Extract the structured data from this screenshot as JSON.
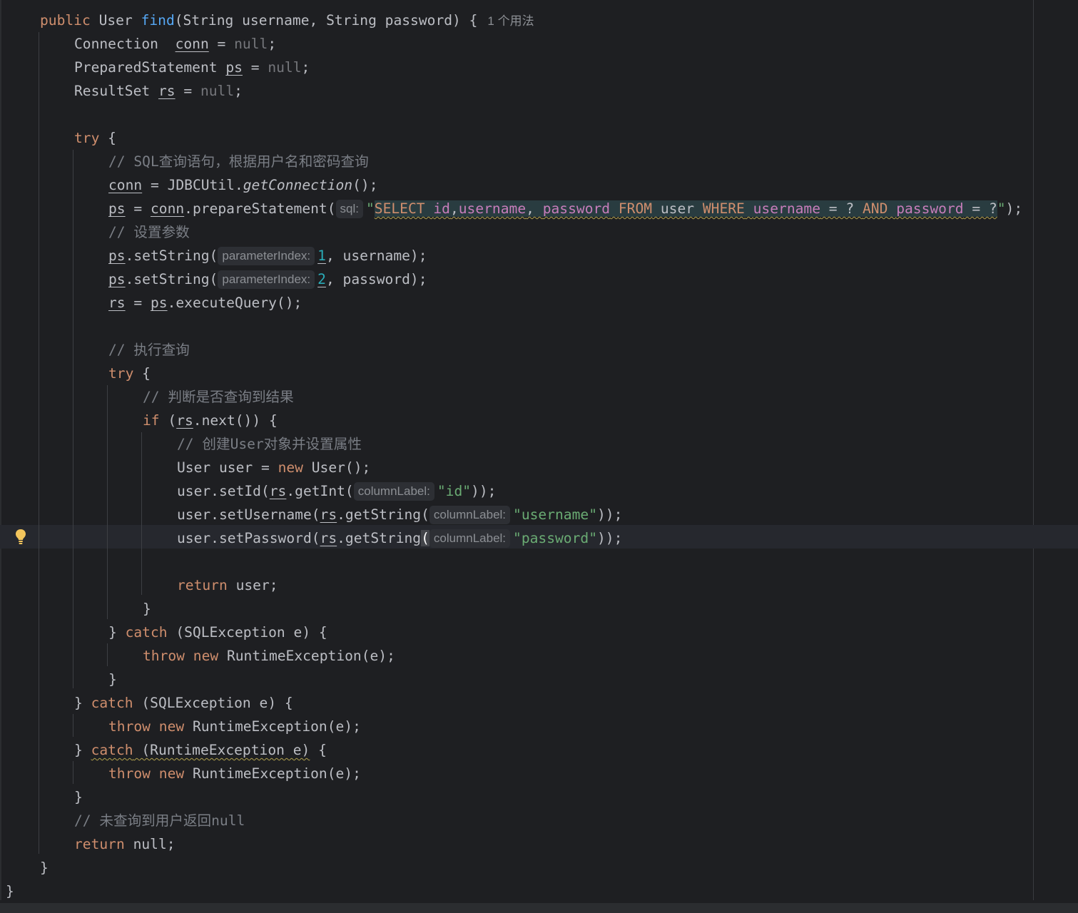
{
  "code": {
    "l1": {
      "kw": "public",
      "type": "User",
      "fn": "find",
      "params": "(String username, String password) {",
      "usage": "1 个用法"
    },
    "l2": {
      "type": "Connection",
      "var": "conn",
      "eq": " = ",
      "null": "null",
      "end": ";"
    },
    "l3": {
      "type": "PreparedStatement",
      "var": "ps",
      "eq": " = ",
      "null": "null",
      "end": ";"
    },
    "l4": {
      "type": "ResultSet",
      "var": "rs",
      "eq": " = ",
      "null": "null",
      "end": ";"
    },
    "l6": {
      "kw": "try",
      "rest": " {"
    },
    "l7": {
      "comment": "// SQL查询语句，根据用户名和密码查询"
    },
    "l8": {
      "var": "conn",
      "eq": " = JDBCUtil.",
      "method": "getConnection",
      "end": "();"
    },
    "l9": {
      "var": "ps",
      "eq": " = ",
      "var2": "conn",
      "call": ".prepareStatement(",
      "hint": "sql:",
      "q1": "\"",
      "sql": [
        "SELECT",
        " ",
        "id",
        ",",
        "username",
        ", ",
        "password",
        " ",
        "FROM",
        " user ",
        "WHERE",
        " ",
        "username",
        " = ? ",
        "AND",
        " ",
        "password",
        " = ?"
      ],
      "q2": "\"",
      "end": ");"
    },
    "l10": {
      "comment": "// 设置参数"
    },
    "l11": {
      "var": "ps",
      "call": ".setString(",
      "hint": "parameterIndex:",
      "num": "1",
      "rest": ", username);"
    },
    "l12": {
      "var": "ps",
      "call": ".setString(",
      "hint": "parameterIndex:",
      "num": "2",
      "rest": ", password);"
    },
    "l13": {
      "var": "rs",
      "eq": " = ",
      "var2": "ps",
      "rest": ".executeQuery();"
    },
    "l15": {
      "comment": "// 执行查询"
    },
    "l16": {
      "kw": "try",
      "rest": " {"
    },
    "l17": {
      "comment": "// 判断是否查询到结果"
    },
    "l18": {
      "kw": "if",
      "open": " (",
      "var": "rs",
      "rest": ".next()) {"
    },
    "l19": {
      "comment": "// 创建User对象并设置属性"
    },
    "l20": {
      "pre": "User user = ",
      "kw": "new",
      "rest": " User();"
    },
    "l21": {
      "pre": "user.setId(",
      "var": "rs",
      "call": ".getInt(",
      "hint": "columnLabel:",
      "str": "\"id\"",
      "end": "));"
    },
    "l22": {
      "pre": "user.setUsername(",
      "var": "rs",
      "call": ".getString(",
      "hint": "columnLabel:",
      "str": "\"username\"",
      "end": "));"
    },
    "l23": {
      "pre": "user.setPassword(",
      "var": "rs",
      "call": ".getString",
      "paren": "(",
      "hint": "columnLabel:",
      "str": "\"password\"",
      "end": "));"
    },
    "l25": {
      "kw": "return",
      "rest": " user;"
    },
    "l26": {
      "text": "}"
    },
    "l27": {
      "pre": "} ",
      "kw": "catch",
      "rest": " (SQLException e) {"
    },
    "l28": {
      "kw": "throw",
      "kw2": "new",
      "rest": " RuntimeException(e);"
    },
    "l29": {
      "text": "}"
    },
    "l30": {
      "pre": "} ",
      "kw": "catch",
      "rest": " (SQLException e) {"
    },
    "l31": {
      "kw": "throw",
      "kw2": "new",
      "rest": " RuntimeException(e);"
    },
    "l32": {
      "pre": "} ",
      "kw": "catch",
      "mid": " (RuntimeException e)",
      "rest": " {"
    },
    "l33": {
      "kw": "throw",
      "kw2": "new",
      "rest": " RuntimeException(e);"
    },
    "l34": {
      "text": "}"
    },
    "l35": {
      "comment": "// 未查询到用户返回null"
    },
    "l36": {
      "kw": "return",
      "rest": " null;"
    },
    "l37": {
      "text": "}"
    },
    "l38": {
      "text": "}"
    }
  },
  "icons": {
    "intention": "lightbulb-icon"
  },
  "colors": {
    "background": "#1e1f22",
    "keyword": "#cf8e6d",
    "function": "#56a8f5",
    "string": "#6aab73",
    "number": "#2aacb8",
    "comment": "#7a7e85",
    "sql_identifier": "#c77dbb"
  }
}
